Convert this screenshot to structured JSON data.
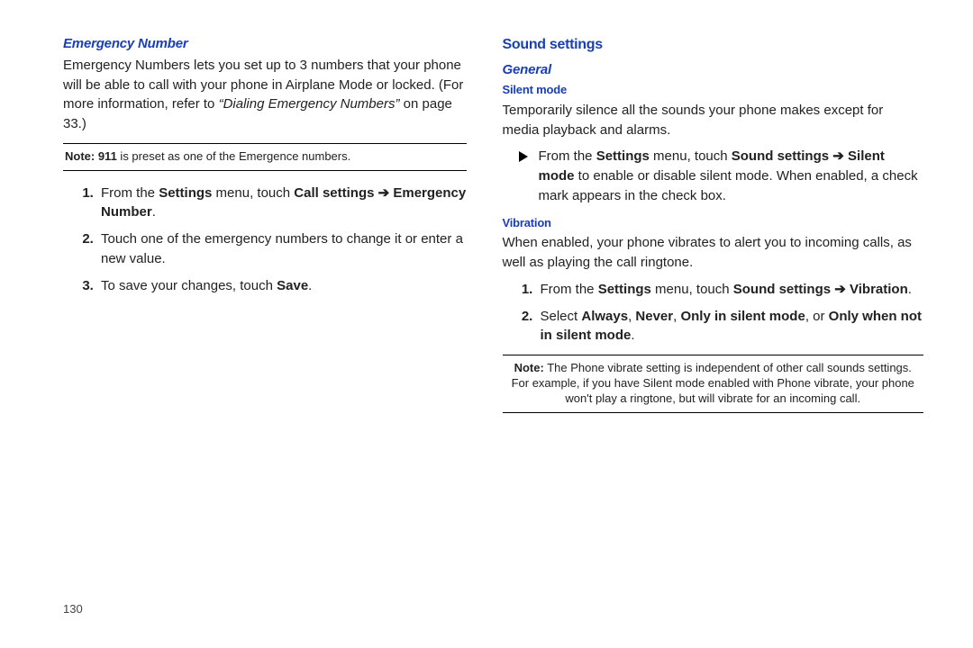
{
  "pageNumber": "130",
  "left": {
    "heading": "Emergency Number",
    "intro_pre": "Emergency Numbers lets you set up to 3 numbers that your phone will be able to call with your phone in Airplane Mode or locked. (For more information, refer to ",
    "intro_ref": "“Dialing Emergency Numbers”",
    "intro_post": " on page 33.)",
    "note_label": "Note: 911",
    "note_rest": " is preset as one of the Emergence numbers.",
    "step1_pre": "From the ",
    "step1_b1": "Settings",
    "step1_mid": " menu, touch ",
    "step1_b2": "Call settings",
    "step1_arrow": " ➔ ",
    "step1_b3": "Emergency Number",
    "step1_end": ".",
    "step2": "Touch one of the emergency numbers to change it or enter a new value.",
    "step3_pre": "To save your changes, touch ",
    "step3_b": "Save",
    "step3_end": "."
  },
  "right": {
    "section": "Sound settings",
    "sub": "General",
    "silentHeading": "Silent mode",
    "silentIntro": "Temporarily silence all the sounds your phone makes except for media playback and alarms.",
    "silent_pre": "From the ",
    "silent_b1": "Settings",
    "silent_mid": " menu, touch ",
    "silent_b2": "Sound settings",
    "silent_arrow": " ➔ ",
    "silent_b3": "Silent mode",
    "silent_post": " to enable or disable silent mode. When enabled, a check mark appears in the check box.",
    "vibHeading": "Vibration",
    "vibIntro": "When enabled, your phone vibrates to alert you to incoming calls, as well as playing the call ringtone.",
    "vib1_pre": "From the ",
    "vib1_b1": "Settings",
    "vib1_mid": " menu, touch ",
    "vib1_b2": "Sound settings",
    "vib1_arrow": " ➔ ",
    "vib1_b3": "Vibration",
    "vib1_end": ".",
    "vib2_pre": "Select ",
    "vib2_b1": "Always",
    "vib2_c1": ", ",
    "vib2_b2": "Never",
    "vib2_c2": ", ",
    "vib2_b3": "Only in silent mode",
    "vib2_c3": ", or ",
    "vib2_b4": "Only when not in silent mode",
    "vib2_end": ".",
    "note2_label": "Note:",
    "note2_body": " The Phone vibrate setting is independent of other call sounds settings. For example, if you have Silent mode enabled with Phone vibrate, your phone won't play a ringtone, but will vibrate for an incoming call."
  }
}
